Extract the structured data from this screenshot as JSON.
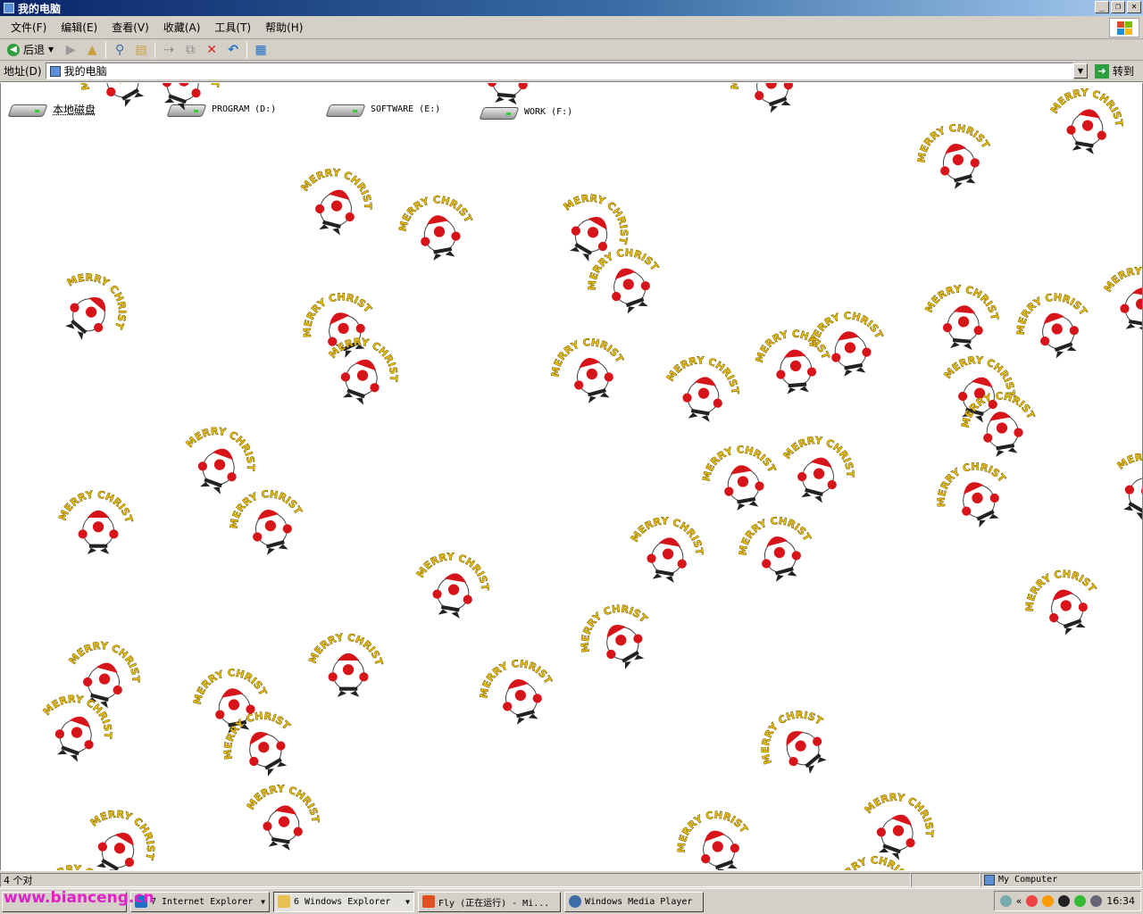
{
  "window": {
    "title": "我的电脑"
  },
  "menu": [
    "文件(F)",
    "编辑(E)",
    "查看(V)",
    "收藏(A)",
    "工具(T)",
    "帮助(H)"
  ],
  "toolbar": {
    "back_label": "后退"
  },
  "address": {
    "label": "地址(D)",
    "value": "我的电脑",
    "go_label": "转到"
  },
  "drives": [
    {
      "label": "本地磁盘"
    },
    {
      "label": "PROGRAM (D:)"
    },
    {
      "label": "SOFTWARE (E:)"
    },
    {
      "label": "WORK (F:)"
    }
  ],
  "sticker_text": "MERRY CHRISTMAS",
  "status": {
    "count": "4 个对",
    "location": "My Computer"
  },
  "taskbar": {
    "buttons": [
      {
        "label": "7 Internet Explorer"
      },
      {
        "label": "6 Windows Explorer"
      },
      {
        "label": "Fly (正在运行) - Mi..."
      },
      {
        "label": "Windows Media Player"
      }
    ],
    "clock": "16:34",
    "watermark": "www.bianceng.cn"
  },
  "colors": {
    "title_start": "#0a246a",
    "title_end": "#a6caf0",
    "chrome": "#d4d0c8",
    "sticker_text": "#f2c500",
    "santa_red": "#d8141b"
  }
}
